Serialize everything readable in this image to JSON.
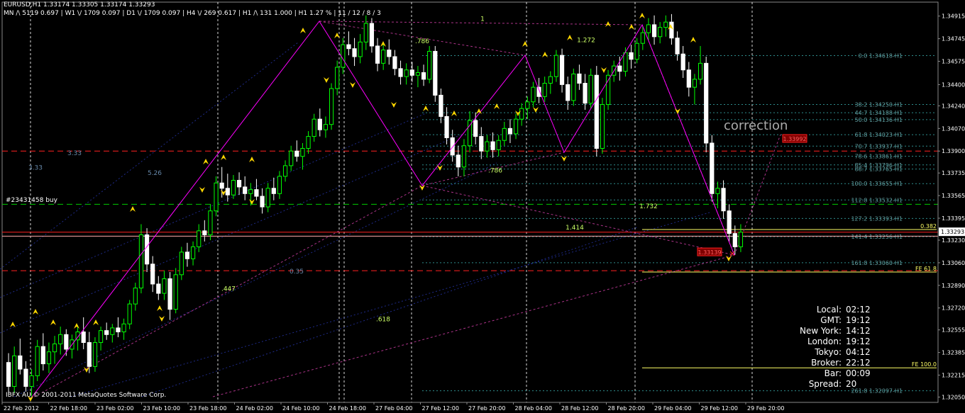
{
  "header": {
    "symbol_line": "EURUSD,H1  1.33174 1.33305 1.33174 1.33293",
    "tf_line": "MN /\\ 5119  0.697  |  W1 \\/ 1709  0.097  |  D1 \\/ 1709  0.097  |  H4 \\/ 269  0.617  |  H1 /\\ 131  1.000  |  H1  1.27 %  |  11 / 12 / 8 / 3"
  },
  "copyright": "IBFX AU © 2001-2011 MetaQuotes Software Corp.",
  "annotation_title": "correction",
  "position_label": "#23431458 buy",
  "clock": [
    {
      "k": "Local:",
      "v": "02:12"
    },
    {
      "k": "GMT:",
      "v": "19:12"
    },
    {
      "k": "New York:",
      "v": "14:12"
    },
    {
      "k": "London:",
      "v": "19:12"
    },
    {
      "k": "Tokyo:",
      "v": "04:12"
    },
    {
      "k": "Broker:",
      "v": "22:12"
    },
    {
      "k": "Bar:",
      "v": "00:09"
    },
    {
      "k": "Spread:",
      "v": "20"
    }
  ],
  "colors": {
    "bull": "#00ff00",
    "bear": "#ffffff",
    "zigzag": "#ff00ff",
    "fibo": "#2e8b8b",
    "fibo_text": "#5f9ea0",
    "red_line": "#ff2020",
    "yellow": "#ffff66",
    "arrow": "#ffd700"
  },
  "chart_data": {
    "type": "candlestick",
    "title": "EURUSD,H1",
    "y_ticks": [
      "1.34915",
      "1.34745",
      "1.34575",
      "1.34400",
      "1.34240",
      "1.34070",
      "1.33900",
      "1.33735",
      "1.33565",
      "1.33395",
      "1.33230",
      "1.33060",
      "1.32890",
      "1.32720",
      "1.32555",
      "1.32385",
      "1.32215",
      "1.32050"
    ],
    "ylim": [
      1.3201,
      1.3502
    ],
    "current_price": "1.33293",
    "x_ticks": [
      "22 Feb 2012",
      "22 Feb 18:00",
      "23 Feb 02:00",
      "23 Feb 10:00",
      "23 Feb 18:00",
      "24 Feb 02:00",
      "24 Feb 10:00",
      "24 Feb 18:00",
      "27 Feb 04:00",
      "27 Feb 12:00",
      "27 Feb 20:00",
      "28 Feb 04:00",
      "28 Feb 12:00",
      "28 Feb 20:00",
      "29 Feb 04:00",
      "29 Feb 12:00",
      "29 Feb 20:00"
    ],
    "fibo_levels": [
      {
        "label": "0.0 1.34618-H1",
        "price": 1.34618
      },
      {
        "label": "38.2 1.34250-H1",
        "price": 1.3425
      },
      {
        "label": "44.7 1.34188-H1",
        "price": 1.34188
      },
      {
        "label": "50.0 1.34136-H1",
        "price": 1.34136
      },
      {
        "label": "61.8 1.34023-H1",
        "price": 1.34023
      },
      {
        "label": "70.7 1.33937-H1",
        "price": 1.33937
      },
      {
        "label": "78.6 1.33861-H1",
        "price": 1.33861
      },
      {
        "label": "85.4 1.33796-H1",
        "price": 1.33796
      },
      {
        "label": "88.7 1.33765-H1",
        "price": 1.33765
      },
      {
        "label": "100.0 1.33655-H1",
        "price": 1.33655
      },
      {
        "label": "112.8 1.33532-H1",
        "price": 1.33532
      },
      {
        "label": "127.2 1.33393-H1",
        "price": 1.33393
      },
      {
        "label": "141.4 1.33256-H1",
        "price": 1.33256
      },
      {
        "label": "161.8 1.33060-H1",
        "price": 1.3306
      },
      {
        "label": "261.8 1.32097-H1",
        "price": 1.32097
      }
    ],
    "price_boxes": [
      {
        "label": "1.33992",
        "price": 1.33992
      },
      {
        "label": "1.33139",
        "price": 1.33139
      }
    ],
    "fe_labels": [
      {
        "label": "0.382",
        "price": 1.3331
      },
      {
        "label": "FE 61.8",
        "price": 1.3299
      },
      {
        "label": "FE 100.0",
        "price": 1.3227
      }
    ],
    "ratio_labels": [
      {
        "label": "3.33",
        "x_index": 0,
        "price": 1.3376
      },
      {
        "label": "3.33",
        "x_index": 1,
        "price": 1.3387
      },
      {
        "label": "5.26",
        "x_index": 2,
        "price": 1.3372
      },
      {
        "label": ".786",
        "x_index": 3,
        "price": 1.3471
      },
      {
        "label": "1",
        "x_index": 4,
        "price": 1.3488
      },
      {
        "label": "1.272",
        "x_index": 5,
        "price": 1.3472
      },
      {
        "label": ".786",
        "x_index": 6,
        "price": 1.3374
      },
      {
        "label": "1.732",
        "x_index": 7,
        "price": 1.3347
      },
      {
        "label": "1.414",
        "x_index": 8,
        "price": 1.3331
      },
      {
        "label": ".447",
        "x_index": 9,
        "price": 1.3285
      },
      {
        "label": "0.35",
        "x_index": 10,
        "price": 1.3298
      },
      {
        "label": ".618",
        "x_index": 11,
        "price": 1.3262
      }
    ],
    "candles": [
      [
        1.3231,
        1.3238,
        1.3207,
        1.3213
      ],
      [
        1.3213,
        1.3243,
        1.3208,
        1.3236
      ],
      [
        1.3236,
        1.3249,
        1.3222,
        1.3226
      ],
      [
        1.3226,
        1.3232,
        1.3209,
        1.3213
      ],
      [
        1.3213,
        1.3226,
        1.3205,
        1.3221
      ],
      [
        1.3221,
        1.3248,
        1.3217,
        1.3243
      ],
      [
        1.3243,
        1.3253,
        1.3225,
        1.323
      ],
      [
        1.323,
        1.3246,
        1.3223,
        1.3239
      ],
      [
        1.3239,
        1.3251,
        1.323,
        1.3245
      ],
      [
        1.3245,
        1.3258,
        1.3237,
        1.3252
      ],
      [
        1.3252,
        1.3256,
        1.3236,
        1.3241
      ],
      [
        1.3241,
        1.3252,
        1.3234,
        1.3248
      ],
      [
        1.3248,
        1.3259,
        1.324,
        1.3254
      ],
      [
        1.3254,
        1.3265,
        1.3241,
        1.3246
      ],
      [
        1.3246,
        1.3254,
        1.3223,
        1.3228
      ],
      [
        1.3228,
        1.325,
        1.3224,
        1.3246
      ],
      [
        1.3246,
        1.3258,
        1.324,
        1.3255
      ],
      [
        1.3255,
        1.3261,
        1.3248,
        1.3252
      ],
      [
        1.3252,
        1.326,
        1.3246,
        1.3257
      ],
      [
        1.3257,
        1.3265,
        1.325,
        1.3254
      ],
      [
        1.3254,
        1.3264,
        1.3248,
        1.326
      ],
      [
        1.326,
        1.3278,
        1.3256,
        1.3275
      ],
      [
        1.3275,
        1.3291,
        1.327,
        1.3287
      ],
      [
        1.3287,
        1.3335,
        1.3283,
        1.3327
      ],
      [
        1.3327,
        1.3332,
        1.3299,
        1.3305
      ],
      [
        1.3305,
        1.3311,
        1.3284,
        1.329
      ],
      [
        1.329,
        1.3296,
        1.3278,
        1.3283
      ],
      [
        1.3283,
        1.33,
        1.3278,
        1.3294
      ],
      [
        1.3294,
        1.3299,
        1.3263,
        1.3271
      ],
      [
        1.3271,
        1.3302,
        1.3268,
        1.3297
      ],
      [
        1.3297,
        1.3318,
        1.3293,
        1.3314
      ],
      [
        1.3314,
        1.3321,
        1.3303,
        1.3309
      ],
      [
        1.3309,
        1.3322,
        1.3304,
        1.3318
      ],
      [
        1.3318,
        1.3335,
        1.3314,
        1.333
      ],
      [
        1.333,
        1.3338,
        1.3322,
        1.3327
      ],
      [
        1.3327,
        1.335,
        1.3323,
        1.3345
      ],
      [
        1.3345,
        1.3371,
        1.3341,
        1.3366
      ],
      [
        1.3366,
        1.3378,
        1.3355,
        1.3362
      ],
      [
        1.3362,
        1.3373,
        1.3352,
        1.3357
      ],
      [
        1.3357,
        1.3372,
        1.3354,
        1.3368
      ],
      [
        1.3368,
        1.3374,
        1.3357,
        1.3363
      ],
      [
        1.3363,
        1.3371,
        1.3353,
        1.3358
      ],
      [
        1.3358,
        1.3366,
        1.3349,
        1.3361
      ],
      [
        1.3361,
        1.3369,
        1.3353,
        1.3356
      ],
      [
        1.3356,
        1.3362,
        1.3343,
        1.3348
      ],
      [
        1.3348,
        1.3366,
        1.3344,
        1.3362
      ],
      [
        1.3362,
        1.337,
        1.3353,
        1.3358
      ],
      [
        1.3358,
        1.3375,
        1.3354,
        1.3371
      ],
      [
        1.3371,
        1.3383,
        1.3367,
        1.3379
      ],
      [
        1.3379,
        1.3394,
        1.3375,
        1.339
      ],
      [
        1.339,
        1.3398,
        1.3382,
        1.3386
      ],
      [
        1.3386,
        1.3396,
        1.3376,
        1.3392
      ],
      [
        1.3392,
        1.3405,
        1.3388,
        1.3401
      ],
      [
        1.3401,
        1.3418,
        1.3397,
        1.3414
      ],
      [
        1.3414,
        1.3422,
        1.3401,
        1.3406
      ],
      [
        1.3406,
        1.3416,
        1.34,
        1.341
      ],
      [
        1.341,
        1.3441,
        1.3406,
        1.3437
      ],
      [
        1.3437,
        1.3458,
        1.3432,
        1.3453
      ],
      [
        1.3453,
        1.3475,
        1.3448,
        1.347
      ],
      [
        1.347,
        1.348,
        1.3462,
        1.3467
      ],
      [
        1.3467,
        1.3475,
        1.3454,
        1.3461
      ],
      [
        1.3461,
        1.3478,
        1.3456,
        1.3472
      ],
      [
        1.3472,
        1.3492,
        1.3466,
        1.3486
      ],
      [
        1.3486,
        1.349,
        1.3464,
        1.3469
      ],
      [
        1.3469,
        1.3475,
        1.345,
        1.3456
      ],
      [
        1.3456,
        1.347,
        1.3451,
        1.3466
      ],
      [
        1.3466,
        1.3474,
        1.3455,
        1.3461
      ],
      [
        1.3461,
        1.3466,
        1.3447,
        1.3452
      ],
      [
        1.3452,
        1.3458,
        1.344,
        1.3446
      ],
      [
        1.3446,
        1.3456,
        1.344,
        1.3451
      ],
      [
        1.3451,
        1.3457,
        1.3442,
        1.3447
      ],
      [
        1.3447,
        1.3454,
        1.3438,
        1.3449
      ],
      [
        1.3449,
        1.3455,
        1.3439,
        1.3444
      ],
      [
        1.3444,
        1.3469,
        1.3441,
        1.3465
      ],
      [
        1.3465,
        1.3469,
        1.3427,
        1.3432
      ],
      [
        1.3432,
        1.3437,
        1.3411,
        1.3416
      ],
      [
        1.3416,
        1.3423,
        1.3395,
        1.34
      ],
      [
        1.34,
        1.3406,
        1.3382,
        1.3387
      ],
      [
        1.3387,
        1.3394,
        1.3371,
        1.3378
      ],
      [
        1.3378,
        1.3399,
        1.3371,
        1.3394
      ],
      [
        1.3394,
        1.342,
        1.3389,
        1.3413
      ],
      [
        1.3413,
        1.3419,
        1.3395,
        1.3401
      ],
      [
        1.3401,
        1.3408,
        1.3384,
        1.339
      ],
      [
        1.339,
        1.3402,
        1.3385,
        1.3397
      ],
      [
        1.3397,
        1.3404,
        1.3385,
        1.3391
      ],
      [
        1.3391,
        1.3402,
        1.3386,
        1.3398
      ],
      [
        1.3398,
        1.3412,
        1.3394,
        1.3407
      ],
      [
        1.3407,
        1.3414,
        1.3396,
        1.3403
      ],
      [
        1.3403,
        1.3418,
        1.3399,
        1.3414
      ],
      [
        1.3414,
        1.3426,
        1.3409,
        1.3422
      ],
      [
        1.3422,
        1.3431,
        1.3414,
        1.3427
      ],
      [
        1.3427,
        1.3442,
        1.3423,
        1.3438
      ],
      [
        1.3438,
        1.3445,
        1.3426,
        1.3431
      ],
      [
        1.3431,
        1.3446,
        1.3427,
        1.3441
      ],
      [
        1.3441,
        1.345,
        1.3433,
        1.3446
      ],
      [
        1.3446,
        1.3466,
        1.3442,
        1.3462
      ],
      [
        1.3462,
        1.3467,
        1.3434,
        1.344
      ],
      [
        1.344,
        1.3446,
        1.3421,
        1.3428
      ],
      [
        1.3428,
        1.3452,
        1.3424,
        1.3448
      ],
      [
        1.3448,
        1.3455,
        1.3436,
        1.3441
      ],
      [
        1.3441,
        1.3448,
        1.3421,
        1.3426
      ],
      [
        1.3426,
        1.3452,
        1.3422,
        1.3447
      ],
      [
        1.3447,
        1.3454,
        1.3386,
        1.3392
      ],
      [
        1.3392,
        1.343,
        1.3388,
        1.3425
      ],
      [
        1.3425,
        1.3451,
        1.3421,
        1.3447
      ],
      [
        1.3447,
        1.3458,
        1.3442,
        1.3454
      ],
      [
        1.3454,
        1.3461,
        1.3443,
        1.345
      ],
      [
        1.345,
        1.3468,
        1.3446,
        1.3464
      ],
      [
        1.3464,
        1.347,
        1.3452,
        1.3459
      ],
      [
        1.3459,
        1.3475,
        1.3456,
        1.3471
      ],
      [
        1.3471,
        1.3484,
        1.3466,
        1.3479
      ],
      [
        1.3479,
        1.349,
        1.3473,
        1.3485
      ],
      [
        1.3485,
        1.3492,
        1.347,
        1.3476
      ],
      [
        1.3476,
        1.3487,
        1.3471,
        1.3483
      ],
      [
        1.3483,
        1.3492,
        1.3476,
        1.3487
      ],
      [
        1.3487,
        1.3493,
        1.347,
        1.3475
      ],
      [
        1.3475,
        1.348,
        1.3458,
        1.3463
      ],
      [
        1.3463,
        1.3469,
        1.3445,
        1.3451
      ],
      [
        1.3451,
        1.3457,
        1.3431,
        1.3438
      ],
      [
        1.3438,
        1.3448,
        1.3425,
        1.3444
      ],
      [
        1.3444,
        1.3469,
        1.344,
        1.3456
      ],
      [
        1.3456,
        1.3461,
        1.3389,
        1.3396
      ],
      [
        1.3396,
        1.3402,
        1.3352,
        1.3358
      ],
      [
        1.3358,
        1.3367,
        1.3347,
        1.3362
      ],
      [
        1.3362,
        1.3368,
        1.3339,
        1.3345
      ],
      [
        1.3345,
        1.335,
        1.3322,
        1.3328
      ],
      [
        1.3328,
        1.3334,
        1.3312,
        1.3318
      ],
      [
        1.3318,
        1.3335,
        1.3314,
        1.3329
      ]
    ]
  }
}
